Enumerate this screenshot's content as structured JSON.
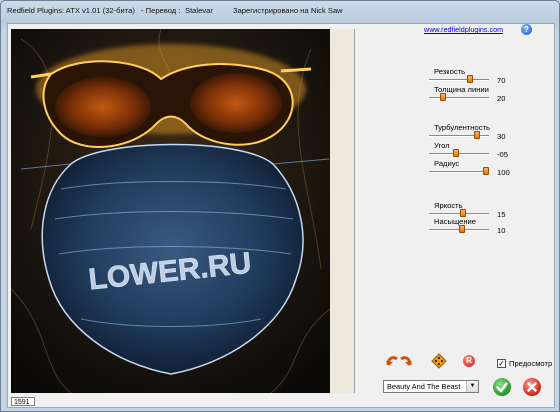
{
  "window": {
    "title_parts": {
      "app": "Redfield Plugins: ATX v1.01 (32-бита)",
      "translation_sep": "-  Перевод :",
      "translator": "Stalevar",
      "registered_label": "Зарегистрировано на :",
      "registered_to": "Nick Saw"
    }
  },
  "header": {
    "link": "www.redfieldplugins.com",
    "help_glyph": "?"
  },
  "params": [
    {
      "label": "Резкость",
      "value": "70",
      "fraction": 0.7
    },
    {
      "label": "Толщина линии",
      "value": "20",
      "fraction": 0.2
    },
    {
      "label": "Турбулентность",
      "value": "30",
      "fraction": 0.83
    },
    {
      "label": "Угол",
      "value": "-05",
      "fraction": 0.45
    },
    {
      "label": "Радиус",
      "value": "100",
      "fraction": 1.0
    },
    {
      "label": "Яркость",
      "value": "15",
      "fraction": 0.57
    },
    {
      "label": "Насыщение",
      "value": "10",
      "fraction": 0.55
    }
  ],
  "preview": {
    "watermark": "LOWER.RU",
    "status": "1591"
  },
  "bottom": {
    "preview_checkbox": {
      "label": "Предосмотр",
      "checked": true,
      "mark": "✓"
    },
    "preset": {
      "selected": "Beauty And The Beast",
      "arrow": "▼"
    },
    "icons": {
      "undo": "undo-redo-arrows-icon",
      "random": "random-dice-icon",
      "reset": "reset-icon",
      "ok": "ok-check-icon",
      "cancel": "cancel-x-icon"
    },
    "reset_glyph": "R"
  },
  "colors": {
    "accent_orange": "#e07a10",
    "ok_green": "#2ea12e",
    "cancel_red": "#d9302a",
    "link_blue": "#0000cc"
  }
}
